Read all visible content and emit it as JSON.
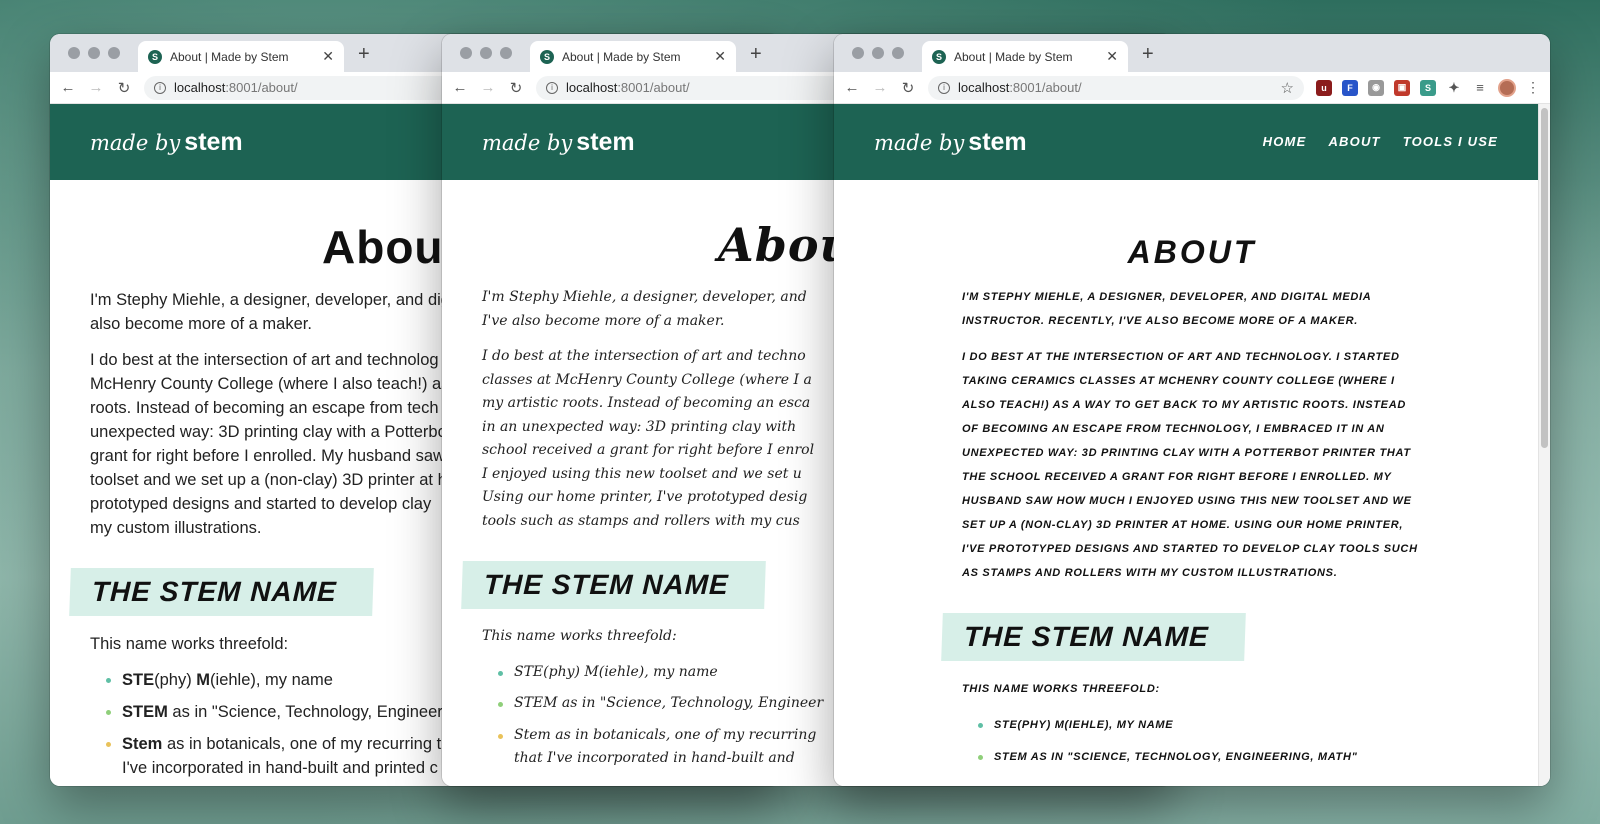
{
  "browser": {
    "tab_title": "About | Made by Stem",
    "tab_favicon": "S",
    "url_host": "localhost",
    "url_rest": ":8001/about/"
  },
  "site": {
    "logo_script": "made by",
    "logo_strong": "stem",
    "nav": [
      "HOME",
      "ABOUT",
      "TOOLS I USE"
    ]
  },
  "win1": {
    "h1": "About",
    "intro": "I'm Stephy Miehle, a designer, developer, and dig",
    "intro2": "also become more of a maker.",
    "para2": [
      "I do best at the intersection of art and technolog",
      "McHenry County College (where I also teach!) as",
      "roots. Instead of becoming an escape from tech",
      "unexpected way: 3D printing clay with a Potterbo",
      "grant for right before I enrolled. My husband saw",
      "toolset and we set up a (non-clay) 3D printer at h",
      "prototyped designs and started to develop clay",
      "my custom illustrations."
    ],
    "h2": "THE STEM NAME",
    "name_intro": "This name works threefold:",
    "li1_bold1": "STE",
    "li1_a": "(phy) ",
    "li1_bold2": "M",
    "li1_b": "(iehle), my name",
    "li2_bold": "STEM",
    "li2_rest": " as in \"Science, Technology, Engineerin",
    "li3_bold": "Stem",
    "li3_rest": " as in botanicals, one of my recurring th",
    "li3_line2": "I've incorporated in hand-built and printed c"
  },
  "win2": {
    "h1": "Abou",
    "intro": "I'm Stephy Miehle, a designer, developer, and",
    "intro2": "I've also become more of a maker.",
    "para2": [
      "I do best at the intersection of art and techno",
      "classes at McHenry County College (where I a",
      "my artistic roots. Instead of becoming an esca",
      "in an unexpected way: 3D printing clay with",
      "school received a grant for right before I enrol",
      "I enjoyed using this new toolset and we set u",
      "Using our home printer, I've prototyped desig",
      "tools such as stamps and rollers with my cus"
    ],
    "h2": "THE STEM NAME",
    "name_intro": "This name works threefold:",
    "li1": "STE(phy) M(iehle), my name",
    "li2": "STEM as in \"Science, Technology, Engineer",
    "li3": "Stem as in botanicals, one of my recurring",
    "li3_line2": "that I've incorporated in hand-built and"
  },
  "win3": {
    "h1": "ABOUT",
    "intro": "I'm Stephy Miehle, a designer, developer, and digital media instructor. Recently, I've also become more of a maker.",
    "para2": "I do best at the intersection of art and technology. I started taking ceramics classes at McHenry County College (where I also teach!) as a way to get back to my artistic roots. Instead of becoming an escape from technology, I embraced it in an unexpected way: 3D printing clay with a Potterbot printer that the school received a grant for right before I enrolled. My husband saw how much I enjoyed using this new toolset and we set up a (non-clay) 3D printer at home. Using our home printer, I've prototyped designs and started to develop clay tools such as stamps and rollers with my custom illustrations.",
    "h2": "THE STEM NAME",
    "name_intro": "This name works threefold:",
    "li1": "STE(phy) M(iehle), my name",
    "li2": "STEM as in \"Science, Technology, Engineering, Math\""
  }
}
